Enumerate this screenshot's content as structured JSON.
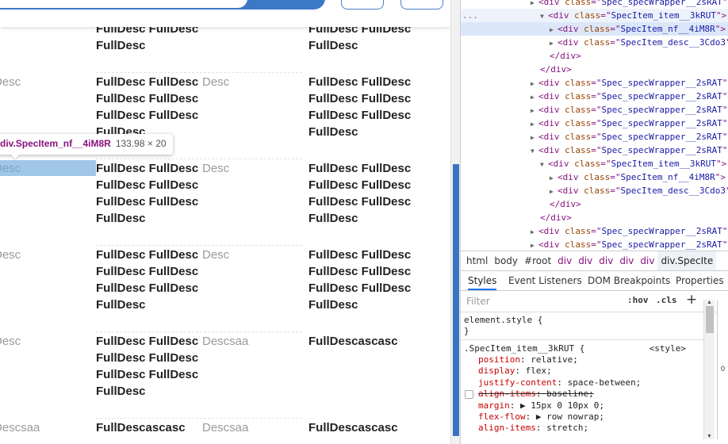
{
  "page": {
    "rows": [
      {
        "left_label": "",
        "left_value": "FullDesc FullDesc\nFullDesc",
        "right_label": "",
        "right_value": "FullDesc FullDesc\nFullDesc"
      },
      {
        "left_label": "Desc",
        "left_value": "FullDesc FullDesc\nFullDesc FullDesc\nFullDesc FullDesc\nFullDesc",
        "right_label": "Desc",
        "right_value": "FullDesc FullDesc\nFullDesc FullDesc\nFullDesc FullDesc\nFullDesc"
      },
      {
        "left_label": "Desc",
        "left_value": "FullDesc FullDesc\nFullDesc FullDesc\nFullDesc FullDesc\nFullDesc",
        "right_label": "Desc",
        "right_value": "FullDesc FullDesc\nFullDesc FullDesc\nFullDesc FullDesc\nFullDesc"
      },
      {
        "left_label": "Desc",
        "left_value": "FullDesc FullDesc\nFullDesc FullDesc\nFullDesc FullDesc\nFullDesc",
        "right_label": "Desc",
        "right_value": "FullDesc FullDesc\nFullDesc FullDesc\nFullDesc FullDesc\nFullDesc"
      },
      {
        "left_label": "Desc",
        "left_value": "FullDesc FullDesc\nFullDesc FullDesc\nFullDesc FullDesc\nFullDesc",
        "right_label": "Descsaa",
        "right_value": "FullDescascasc"
      },
      {
        "left_label": "Descsaa",
        "left_value": "FullDescascasc",
        "right_label": "Descsaa",
        "right_value": "FullDescascasc"
      }
    ],
    "tooltip": {
      "name": "div.SpecItem_nf__4iM8R",
      "size": "133.98 × 20"
    }
  },
  "devtools": {
    "dom_lines": [
      {
        "indent": 5,
        "tri": "▶",
        "tag": "div",
        "cls": "Spec_specWrapper__2sRAT",
        "state": ""
      },
      {
        "indent": 6,
        "tri": "▼",
        "tag": "div",
        "cls": "SpecItem_item__3kRUT",
        "state": "hover",
        "dots": "..."
      },
      {
        "indent": 7,
        "tri": "▶",
        "tag": "div",
        "cls": "SpecItem_nf__4iM8R",
        "state": "selected"
      },
      {
        "indent": 7,
        "tri": "▶",
        "tag": "div",
        "cls": "SpecItem_desc__3Cdo3",
        "state": ""
      },
      {
        "indent": 7,
        "close": "</div>"
      },
      {
        "indent": 6,
        "close": "</div>"
      },
      {
        "indent": 5,
        "tri": "▶",
        "tag": "div",
        "cls": "Spec_specWrapper__2sRAT",
        "state": ""
      },
      {
        "indent": 5,
        "tri": "▶",
        "tag": "div",
        "cls": "Spec_specWrapper__2sRAT",
        "state": ""
      },
      {
        "indent": 5,
        "tri": "▶",
        "tag": "div",
        "cls": "Spec_specWrapper__2sRAT",
        "state": ""
      },
      {
        "indent": 5,
        "tri": "▶",
        "tag": "div",
        "cls": "Spec_specWrapper__2sRAT",
        "state": ""
      },
      {
        "indent": 5,
        "tri": "▶",
        "tag": "div",
        "cls": "Spec_specWrapper__2sRAT",
        "state": ""
      },
      {
        "indent": 5,
        "tri": "▼",
        "tag": "div",
        "cls": "Spec_specWrapper__2sRAT",
        "state": ""
      },
      {
        "indent": 6,
        "tri": "▼",
        "tag": "div",
        "cls": "SpecItem_item__3kRUT",
        "state": ""
      },
      {
        "indent": 7,
        "tri": "▶",
        "tag": "div",
        "cls": "SpecItem_nf__4iM8R",
        "state": ""
      },
      {
        "indent": 7,
        "tri": "▶",
        "tag": "div",
        "cls": "SpecItem_desc__3Cdo3",
        "state": ""
      },
      {
        "indent": 7,
        "close": "</div>"
      },
      {
        "indent": 6,
        "close": "</div>"
      },
      {
        "indent": 5,
        "tri": "▶",
        "tag": "div",
        "cls": "Spec_specWrapper__2sRAT",
        "state": ""
      },
      {
        "indent": 5,
        "tri": "▶",
        "tag": "div",
        "cls": "Spec_specWrapper__2sRAT",
        "state": ""
      }
    ],
    "breadcrumbs": [
      "html",
      "body",
      "#root",
      "div",
      "div",
      "div",
      "div",
      "div",
      "div.SpecIte"
    ],
    "tabs": [
      "Styles",
      "Event Listeners",
      "DOM Breakpoints",
      "Properties"
    ],
    "filter_placeholder": "Filter",
    "hov_label": ":hov",
    "cls_label": ".cls",
    "plus_label": "+",
    "element_style": "element.style {",
    "element_style_close": "}",
    "rule_selector": ".SpecItem_item__3kRUT {",
    "rule_source": "<style>",
    "declarations": [
      {
        "prop": "position",
        "value": "relative;",
        "struck": false,
        "checkbox": false
      },
      {
        "prop": "display",
        "value": "flex;",
        "struck": false,
        "checkbox": false
      },
      {
        "prop": "justify-content",
        "value": "space-between;",
        "struck": false,
        "checkbox": false
      },
      {
        "prop": "align-items",
        "value": "baseline;",
        "struck": true,
        "checkbox": true
      },
      {
        "prop": "margin",
        "value": "▶ 15px 0 10px 0;",
        "struck": false,
        "checkbox": false
      },
      {
        "prop": "flex-flow",
        "value": "▶ row nowrap;",
        "struck": false,
        "checkbox": false
      },
      {
        "prop": "align-items",
        "value": "stretch;",
        "struck": false,
        "checkbox": false
      }
    ],
    "box_model_edge": "0"
  },
  "colors": {
    "accent": "#3d78c6",
    "selection": "#dbe7f8",
    "highlight": "#6fa8dc"
  }
}
